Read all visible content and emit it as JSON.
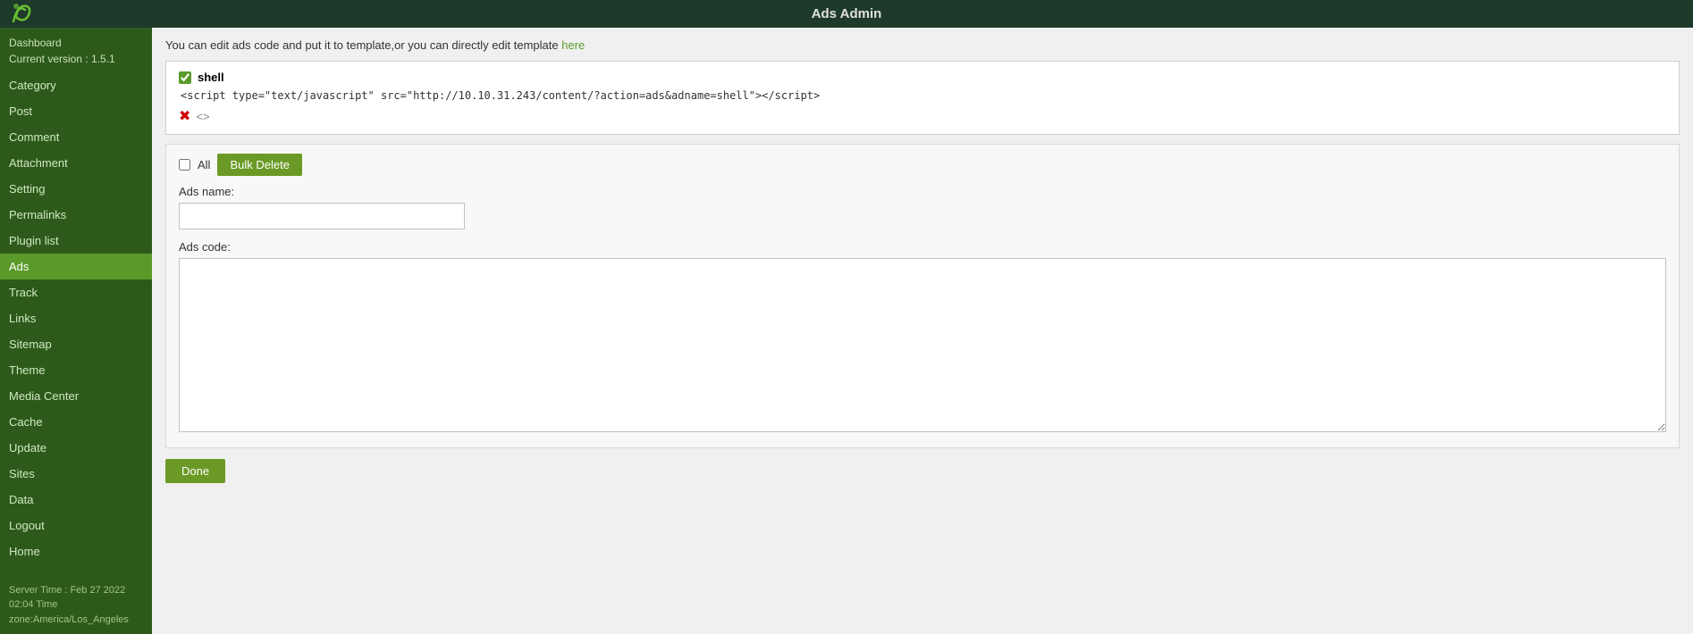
{
  "header": {
    "title": "Ads Admin",
    "logo_alt": "logo"
  },
  "sidebar": {
    "dashboard_line1": "Dashboard",
    "dashboard_line2": "Current version : 1.5.1",
    "items": [
      {
        "label": "Category",
        "id": "category",
        "active": false
      },
      {
        "label": "Post",
        "id": "post",
        "active": false
      },
      {
        "label": "Comment",
        "id": "comment",
        "active": false
      },
      {
        "label": "Attachment",
        "id": "attachment",
        "active": false
      },
      {
        "label": "Setting",
        "id": "setting",
        "active": false
      },
      {
        "label": "Permalinks",
        "id": "permalinks",
        "active": false
      },
      {
        "label": "Plugin list",
        "id": "plugin-list",
        "active": false
      },
      {
        "label": "Ads",
        "id": "ads",
        "active": true
      },
      {
        "label": "Track",
        "id": "track",
        "active": false
      },
      {
        "label": "Links",
        "id": "links",
        "active": false
      },
      {
        "label": "Sitemap",
        "id": "sitemap",
        "active": false
      },
      {
        "label": "Theme",
        "id": "theme",
        "active": false
      },
      {
        "label": "Media Center",
        "id": "media-center",
        "active": false
      },
      {
        "label": "Cache",
        "id": "cache",
        "active": false
      },
      {
        "label": "Update",
        "id": "update",
        "active": false
      },
      {
        "label": "Sites",
        "id": "sites",
        "active": false
      },
      {
        "label": "Data",
        "id": "data",
        "active": false
      },
      {
        "label": "Logout",
        "id": "logout",
        "active": false
      },
      {
        "label": "Home",
        "id": "home",
        "active": false
      }
    ],
    "footer_line1": "Server Time : Feb 27 2022",
    "footer_line2": "02:04 Time",
    "footer_line3": "zone:America/Los_Angeles"
  },
  "content": {
    "info_text": "You can edit ads code and put it to template,or you can directly edit template ",
    "info_link_text": "here",
    "ads_entry": {
      "checked": true,
      "name": "shell",
      "code": "<script type=\"text/javascript\" src=\"http://10.10.31.243/content/?action=ads&adname=shell\"></script>"
    },
    "form": {
      "all_label": "All",
      "bulk_delete_label": "Bulk Delete",
      "ads_name_label": "Ads name:",
      "ads_name_placeholder": "",
      "ads_code_label": "Ads code:",
      "ads_code_placeholder": "",
      "done_label": "Done"
    }
  }
}
